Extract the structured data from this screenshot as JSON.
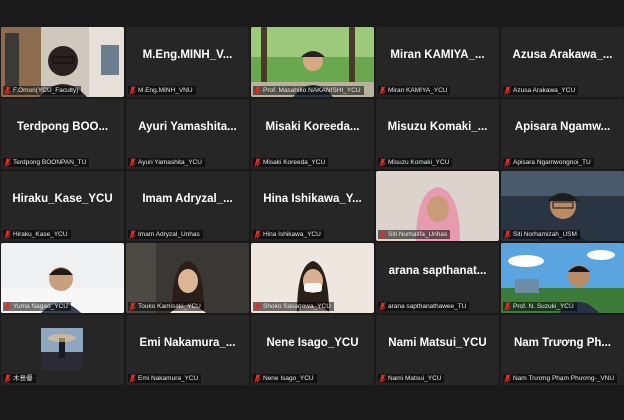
{
  "colors": {
    "background": "#1a1a1a",
    "tile": "#262626",
    "mic_muted": "#d9302c",
    "active_speaker": "#f1e05a"
  },
  "participants": [
    {
      "name": "F.Omori(YCU_Faculty)",
      "display": "",
      "video": "room"
    },
    {
      "name": "M.Eng.MINH_VNU",
      "display": "M.Eng.MINH_V..."
    },
    {
      "name": "Prof. Masahiko NAKANISHI_YCU",
      "display": "",
      "video": "park"
    },
    {
      "name": "Miran KAMIYA_YCU",
      "display": "Miran  KAMIYA_..."
    },
    {
      "name": "Azusa Arakawa_YCU",
      "display": "Azusa  Arakawa_..."
    },
    {
      "name": "Terdpong BOONPAN_TU",
      "display": "Terdpong  BOO..."
    },
    {
      "name": "Ayuri Yamashita_YCU",
      "display": "Ayuri  Yamashita..."
    },
    {
      "name": "Misaki Koreeda_YCU",
      "display": "Misaki  Koreeda..."
    },
    {
      "name": "Misuzu Komaki_YCU",
      "display": "Misuzu  Komaki_..."
    },
    {
      "name": "Apisara Ngamwongnoi_TU",
      "display": "Apisara  Ngamw..."
    },
    {
      "name": "Hiraku_Kase_YCU",
      "display": "Hiraku_Kase_YCU"
    },
    {
      "name": "Imam Adryzal_Unhas",
      "display": "Imam  Adryzal_..."
    },
    {
      "name": "Hina Ishikawa_YCU",
      "display": "Hina  Ishikawa_Y..."
    },
    {
      "name": "Siti Nurhalifa_Unhas",
      "display": "",
      "video": "hijab"
    },
    {
      "name": "Siti Norhamizah_USM",
      "display": "",
      "video": "cap"
    },
    {
      "name": "Yuma Nagao_YCU",
      "display": "",
      "video": "white"
    },
    {
      "name": "Touko Kamisaki_YCU",
      "display": "",
      "video": "dark"
    },
    {
      "name": "Shoko Sasagawa_YCU",
      "display": "",
      "video": "mask"
    },
    {
      "name": "arana sapthanathawee_TU",
      "display": "arana  sapthanat..."
    },
    {
      "name": "Prof. N. Suzuki_YCU",
      "display": "",
      "video": "sky",
      "active": true
    },
    {
      "name": "木島優",
      "display": "",
      "video": "thumb"
    },
    {
      "name": "Emi Nakamura_YCU",
      "display": "Emi  Nakamura_..."
    },
    {
      "name": "Nene Isago_YCU",
      "display": "Nene  Isago_YCU"
    },
    {
      "name": "Nami Matsui_YCU",
      "display": "Nami  Matsui_YCU"
    },
    {
      "name": "Nam Trương Phạm Phương-_VNU",
      "display": "Nam  Trương  Ph..."
    }
  ]
}
